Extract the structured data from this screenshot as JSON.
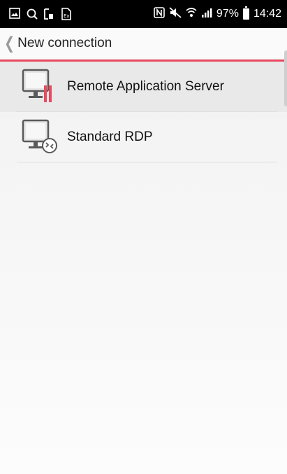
{
  "status_bar": {
    "battery_percent": "97%",
    "battery_level": 0.97,
    "time": "14:42",
    "left_icons": [
      "gallery-icon",
      "search-icon",
      "screenshot-icon",
      "sim-icon"
    ],
    "right_icons": [
      "nfc-icon",
      "mute-icon",
      "wifi-icon",
      "signal-icon",
      "battery-icon"
    ]
  },
  "header": {
    "back_glyph": "❮",
    "title": "New connection",
    "accent_color": "#e84a5f"
  },
  "items": [
    {
      "label": "Remote Application Server",
      "icon": "remote-app-server-icon"
    },
    {
      "label": "Standard RDP",
      "icon": "standard-rdp-icon"
    }
  ]
}
